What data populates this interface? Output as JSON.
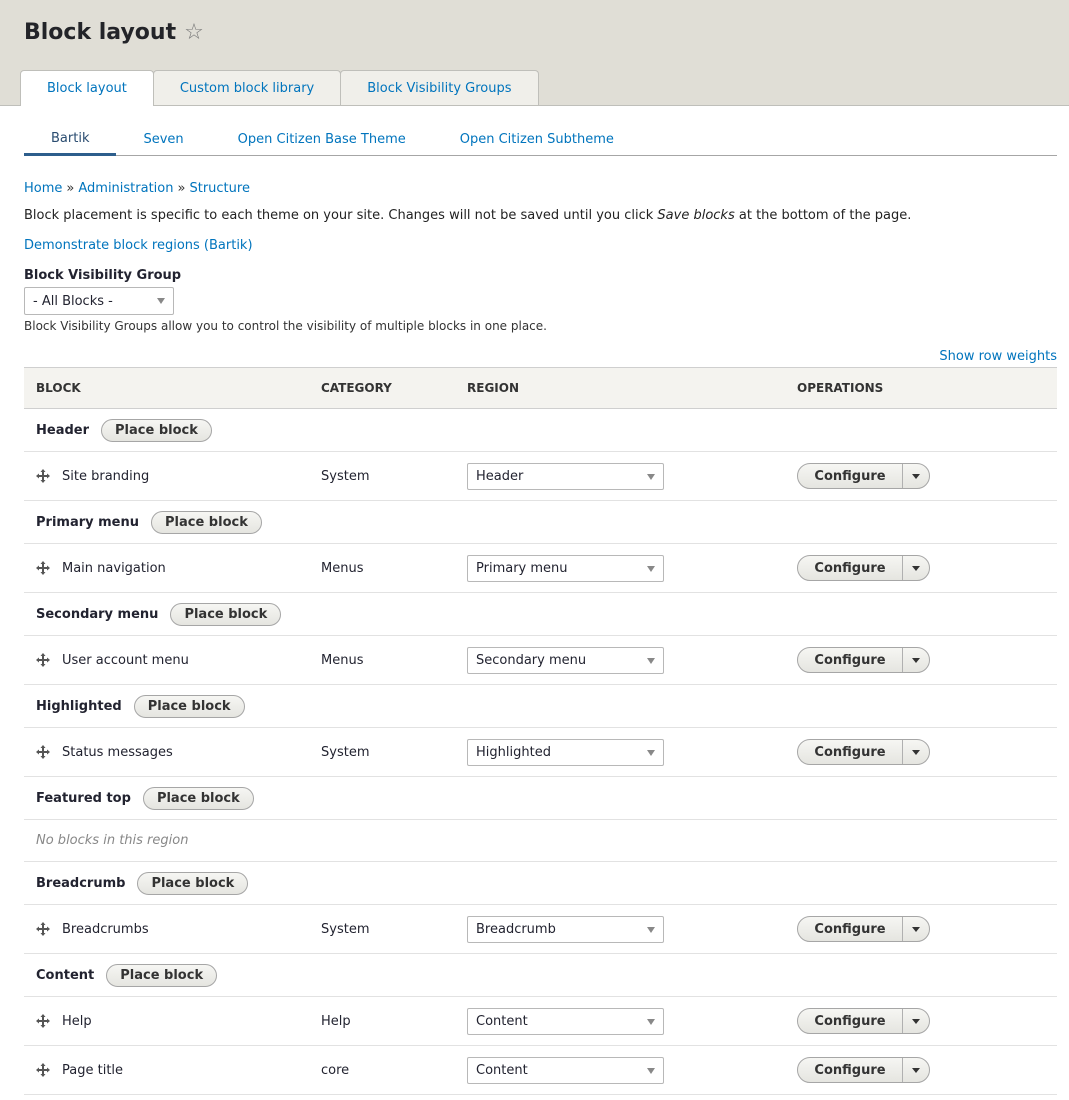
{
  "page": {
    "title": "Block layout",
    "primary_tabs": [
      "Block layout",
      "Custom block library",
      "Block Visibility Groups"
    ],
    "secondary_tabs": [
      "Bartik",
      "Seven",
      "Open Citizen Base Theme",
      "Open Citizen Subtheme"
    ],
    "breadcrumb": [
      "Home",
      "Administration",
      "Structure"
    ],
    "breadcrumb_sep": "»",
    "help_prefix": "Block placement is specific to each theme on your site. Changes will not be saved until you click ",
    "help_em": "Save blocks",
    "help_suffix": " at the bottom of the page.",
    "demo_link": "Demonstrate block regions (Bartik)",
    "bvg_label": "Block Visibility Group",
    "bvg_value": "- All Blocks -",
    "bvg_desc": "Block Visibility Groups allow you to control the visibility of multiple blocks in one place.",
    "row_weights_link": "Show row weights"
  },
  "table": {
    "headers": [
      "Block",
      "Category",
      "Region",
      "Operations"
    ],
    "place_label": "Place block",
    "configure_label": "Configure",
    "regions": [
      {
        "name": "Header",
        "blocks": [
          {
            "name": "Site branding",
            "category": "System",
            "region": "Header"
          }
        ]
      },
      {
        "name": "Primary menu",
        "blocks": [
          {
            "name": "Main navigation",
            "category": "Menus",
            "region": "Primary menu"
          }
        ]
      },
      {
        "name": "Secondary menu",
        "blocks": [
          {
            "name": "User account menu",
            "category": "Menus",
            "region": "Secondary menu"
          }
        ]
      },
      {
        "name": "Highlighted",
        "blocks": [
          {
            "name": "Status messages",
            "category": "System",
            "region": "Highlighted"
          }
        ]
      },
      {
        "name": "Featured top",
        "blocks": [],
        "empty_text": "No blocks in this region"
      },
      {
        "name": "Breadcrumb",
        "blocks": [
          {
            "name": "Breadcrumbs",
            "category": "System",
            "region": "Breadcrumb"
          }
        ]
      },
      {
        "name": "Content",
        "blocks": [
          {
            "name": "Help",
            "category": "Help",
            "region": "Content"
          },
          {
            "name": "Page title",
            "category": "core",
            "region": "Content"
          }
        ]
      }
    ]
  },
  "colors": {
    "link": "#0074bd",
    "header_bg": "#e0ded6"
  }
}
